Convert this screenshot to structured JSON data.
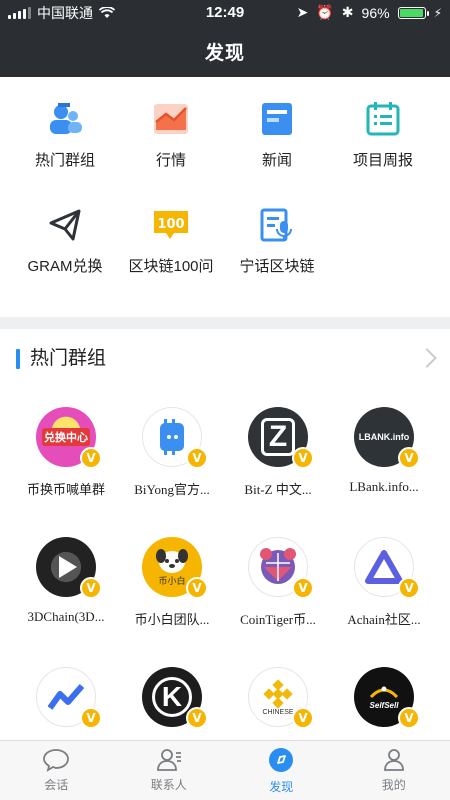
{
  "status_bar": {
    "carrier": "中国联通",
    "time": "12:49",
    "battery_percent": "96%",
    "battery_level": 0.96
  },
  "header": {
    "title": "发现"
  },
  "features": [
    {
      "label": "热门群组",
      "icon": "hot-groups-icon"
    },
    {
      "label": "行情",
      "icon": "market-chart-icon"
    },
    {
      "label": "新闻",
      "icon": "news-icon"
    },
    {
      "label": "项目周报",
      "icon": "weekly-report-icon"
    },
    {
      "label": "GRAM兑换",
      "icon": "gram-send-icon"
    },
    {
      "label": "区块链100问",
      "icon": "blockchain-100-icon"
    },
    {
      "label": "宁话区块链",
      "icon": "voice-blockchain-icon"
    }
  ],
  "hot_groups": {
    "title": "热门群组",
    "items": [
      {
        "name": "币换币喊单群",
        "avatar_text": "兑换中心"
      },
      {
        "name": "BiYong官方...",
        "avatar_text": ""
      },
      {
        "name": "Bit-Z 中文...",
        "avatar_text": "Z"
      },
      {
        "name": "LBank.info...",
        "avatar_text": "LBANK.info"
      },
      {
        "name": "3DChain(3D...",
        "avatar_text": ""
      },
      {
        "name": "币小白团队...",
        "avatar_text": "币小白"
      },
      {
        "name": "CoinTiger币...",
        "avatar_text": ""
      },
      {
        "name": "Achain社区...",
        "avatar_text": ""
      },
      {
        "name": "",
        "avatar_text": ""
      },
      {
        "name": "",
        "avatar_text": "K"
      },
      {
        "name": "",
        "avatar_text": "CHINESE"
      },
      {
        "name": "",
        "avatar_text": "SelfSell"
      }
    ],
    "badge": "V"
  },
  "tabs": [
    {
      "label": "会话",
      "icon": "chat-bubble-icon"
    },
    {
      "label": "联系人",
      "icon": "contacts-icon"
    },
    {
      "label": "发现",
      "icon": "compass-icon",
      "active": true
    },
    {
      "label": "我的",
      "icon": "profile-icon"
    }
  ],
  "colors": {
    "accent": "#2a8ef0",
    "header_bg": "#2b2f34",
    "badge": "#f6b500"
  }
}
